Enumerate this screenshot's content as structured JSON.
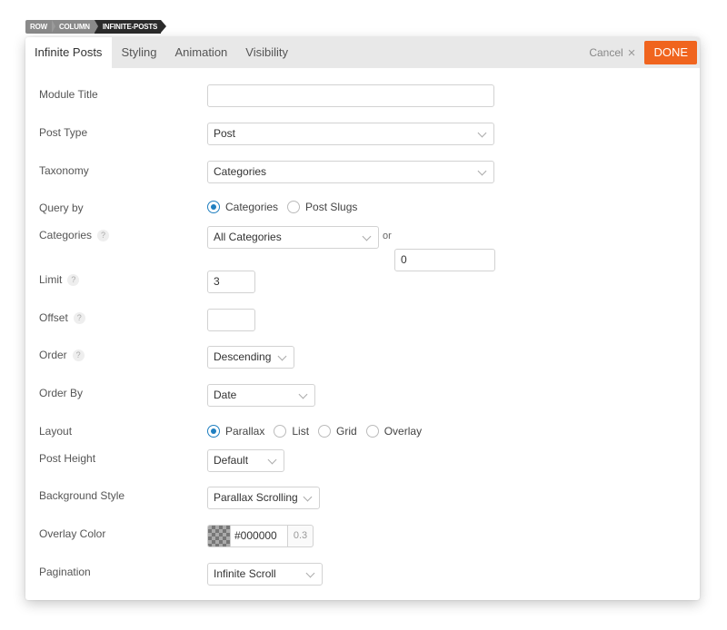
{
  "breadcrumb": [
    "ROW",
    "COLUMN",
    "INFINITE-POSTS"
  ],
  "tabs": [
    {
      "label": "Infinite Posts",
      "active": true
    },
    {
      "label": "Styling",
      "active": false
    },
    {
      "label": "Animation",
      "active": false
    },
    {
      "label": "Visibility",
      "active": false
    }
  ],
  "actions": {
    "cancel_label": "Cancel",
    "cancel_icon": "×",
    "done_label": "DONE"
  },
  "colors": {
    "accent": "#f0641e",
    "radio_selected": "#1f7fc0"
  },
  "help_icon": "?",
  "form": {
    "module_title": {
      "label": "Module Title",
      "value": ""
    },
    "post_type": {
      "label": "Post Type",
      "value": "Post"
    },
    "taxonomy": {
      "label": "Taxonomy",
      "value": "Categories"
    },
    "query_by": {
      "label": "Query by",
      "options": [
        "Categories",
        "Post Slugs"
      ],
      "selected": "Categories"
    },
    "categories": {
      "label": "Categories",
      "value": "All Categories",
      "or_label": "or",
      "id_value": "0"
    },
    "limit": {
      "label": "Limit",
      "value": "3"
    },
    "offset": {
      "label": "Offset",
      "value": ""
    },
    "order": {
      "label": "Order",
      "value": "Descending"
    },
    "order_by": {
      "label": "Order By",
      "value": "Date"
    },
    "layout": {
      "label": "Layout",
      "options": [
        "Parallax",
        "List",
        "Grid",
        "Overlay"
      ],
      "selected": "Parallax"
    },
    "post_height": {
      "label": "Post Height",
      "value": "Default"
    },
    "background_style": {
      "label": "Background Style",
      "value": "Parallax Scrolling"
    },
    "overlay_color": {
      "label": "Overlay Color",
      "hex": "#000000",
      "opacity": "0.3"
    },
    "pagination": {
      "label": "Pagination",
      "value": "Infinite Scroll"
    }
  }
}
